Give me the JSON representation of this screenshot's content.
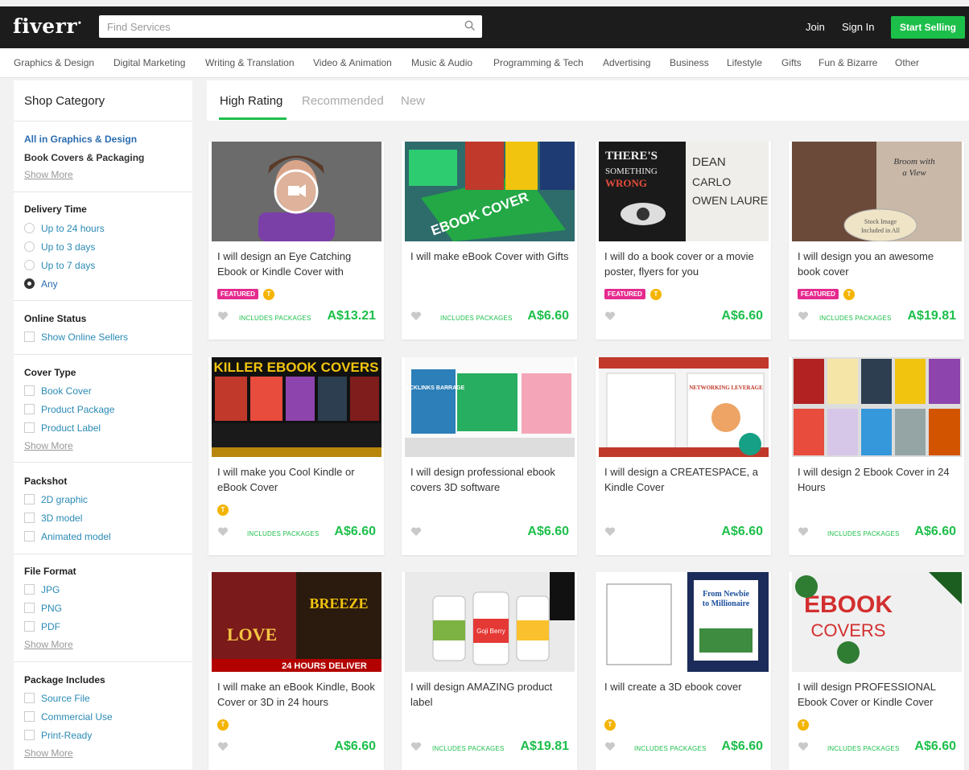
{
  "header": {
    "logo": "fiverr",
    "search_placeholder": "Find Services",
    "join": "Join",
    "sign_in": "Sign In",
    "start_selling": "Start Selling"
  },
  "categories": [
    "Graphics & Design",
    "Digital Marketing",
    "Writing & Translation",
    "Video & Animation",
    "Music & Audio",
    "Programming & Tech",
    "Advertising",
    "Business",
    "Lifestyle",
    "Gifts",
    "Fun & Bizarre",
    "Other"
  ],
  "sidebar": {
    "title": "Shop Category",
    "all_link": "All in Graphics & Design",
    "current": "Book Covers & Packaging",
    "show_more": "Show More",
    "delivery": {
      "heading": "Delivery Time",
      "options": [
        "Up to 24 hours",
        "Up to 3 days",
        "Up to 7 days",
        "Any"
      ],
      "selected": "Any"
    },
    "online": {
      "heading": "Online Status",
      "options": [
        "Show Online Sellers"
      ]
    },
    "cover_type": {
      "heading": "Cover Type",
      "options": [
        "Book Cover",
        "Product Package",
        "Product Label"
      ]
    },
    "packshot": {
      "heading": "Packshot",
      "options": [
        "2D graphic",
        "3D model",
        "Animated model"
      ]
    },
    "file_format": {
      "heading": "File Format",
      "options": [
        "JPG",
        "PNG",
        "PDF"
      ]
    },
    "package": {
      "heading": "Package Includes",
      "options": [
        "Source File",
        "Commercial Use",
        "Print-Ready"
      ]
    }
  },
  "tabs": [
    "High Rating",
    "Recommended",
    "New"
  ],
  "labels": {
    "featured": "FEATURED",
    "includes": "INCLUDES PACKAGES",
    "level": "T"
  },
  "gigs": [
    {
      "title": "I will design an Eye Catching Ebook or Kindle Cover with",
      "price": "A$13.21",
      "featured": true,
      "level": true,
      "includes": true,
      "thumb": "video",
      "thumb_text": ""
    },
    {
      "title": "I will make eBook Cover with Gifts",
      "price": "A$6.60",
      "featured": false,
      "level": false,
      "includes": true,
      "thumb": "ebook",
      "thumb_text": "EBOOK COVER"
    },
    {
      "title": "I will do a book cover or a movie poster, flyers for you",
      "price": "A$6.60",
      "featured": true,
      "level": true,
      "includes": false,
      "thumb": "poster",
      "thumb_text": "OWEN LAUREN"
    },
    {
      "title": "I will design you an awesome book cover",
      "price": "A$19.81",
      "featured": true,
      "level": true,
      "includes": true,
      "thumb": "broom",
      "thumb_text": "Broom with a View"
    },
    {
      "title": "I will make you Cool Kindle or eBook Cover",
      "price": "A$6.60",
      "featured": false,
      "level": true,
      "includes": true,
      "thumb": "killer",
      "thumb_text": "KILLER EBOOK COVERS"
    },
    {
      "title": "I will design professional ebook covers 3D software",
      "price": "A$6.60",
      "featured": false,
      "level": false,
      "includes": false,
      "thumb": "threed",
      "thumb_text": "BACKLINKS BARRAGE"
    },
    {
      "title": "I will design a CREATESPACE, a Kindle Cover",
      "price": "A$6.60",
      "featured": false,
      "level": false,
      "includes": false,
      "thumb": "createspace",
      "thumb_text": "NETWORKING LEVERAGE"
    },
    {
      "title": "I will design 2 Ebook Cover in 24 Hours",
      "price": "A$6.60",
      "featured": false,
      "level": false,
      "includes": true,
      "thumb": "grid",
      "thumb_text": ""
    },
    {
      "title": "I will make an eBook Kindle, Book Cover or 3D in 24 hours",
      "price": "A$6.60",
      "featured": false,
      "level": true,
      "includes": false,
      "thumb": "love",
      "thumb_text": "24 HOURS DELIVER"
    },
    {
      "title": "I will design AMAZING product label",
      "price": "A$19.81",
      "featured": false,
      "level": false,
      "includes": true,
      "thumb": "bottles",
      "thumb_text": "Goji Berry"
    },
    {
      "title": "I will create a 3D ebook cover",
      "price": "A$6.60",
      "featured": false,
      "level": true,
      "includes": true,
      "thumb": "newbie",
      "thumb_text": "From Newbie to Millionaire"
    },
    {
      "title": "I will design PROFESSIONAL Ebook Cover or Kindle Cover",
      "price": "A$6.60",
      "featured": false,
      "level": true,
      "includes": true,
      "thumb": "pro",
      "thumb_text": "EBOOK COVERS"
    }
  ],
  "colors": {
    "accent": "#1dbf4b",
    "featured": "#e52a8e",
    "level": "#f4b400",
    "topbar": "#1c1c1c"
  }
}
